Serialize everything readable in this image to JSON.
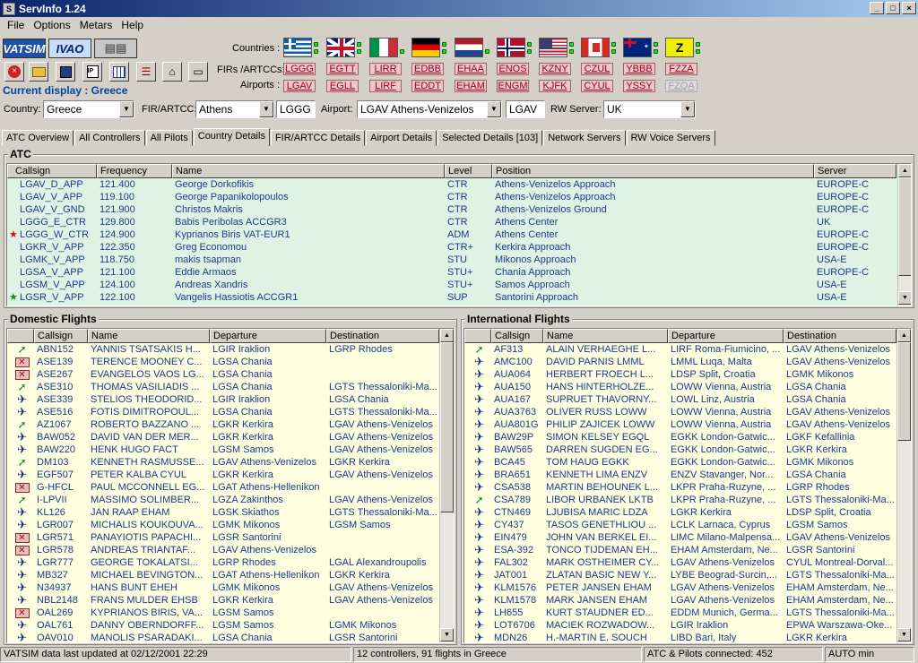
{
  "window": {
    "title": "ServInfo 1.24",
    "icon_text": "S"
  },
  "menu": [
    "File",
    "Options",
    "Metars",
    "Help"
  ],
  "logos": {
    "vatsim": "VATSIM",
    "ivao": "IVAO"
  },
  "toolbar": {
    "icons": [
      "close-icon",
      "folder-icon",
      "save-icon",
      "flightplan-icon",
      "grid-icon",
      "list-icon",
      "binoculars-icon",
      "message-icon"
    ]
  },
  "current_display": "Current display : Greece",
  "labels": {
    "countries": "Countries :",
    "firs": "FIRs /ARTCCs:",
    "airports": "Airports :",
    "country": "Country:",
    "fir": "FIR/ARTCC:",
    "airport": "Airport:",
    "rw_server": "RW Server:"
  },
  "flags": [
    {
      "name": "greece"
    },
    {
      "name": "united-kingdom"
    },
    {
      "name": "italy"
    },
    {
      "name": "germany"
    },
    {
      "name": "netherlands"
    },
    {
      "name": "norway"
    },
    {
      "name": "usa"
    },
    {
      "name": "canada"
    },
    {
      "name": "australia"
    },
    {
      "name": "z",
      "text": "Z"
    }
  ],
  "firs": [
    "LGGG",
    "EGTT",
    "LIRR",
    "EDBB",
    "EHAA",
    "ENOS",
    "KZNY",
    "CZUL",
    "YBBB",
    "FZZA"
  ],
  "airports": [
    "LGAV",
    "EGLL",
    "LIRF",
    "EDDT",
    "EHAM",
    "ENGM",
    "KJFK",
    "CYUL",
    "YSSY",
    "FZQA"
  ],
  "combos": {
    "country": "Greece",
    "fir": "Athens",
    "fir_code": "LGGG",
    "airport": "LGAV Athens-Venizelos",
    "airport_code": "LGAV",
    "rw_server": "UK"
  },
  "tabs": [
    "ATC Overview",
    "All Controllers",
    "All Pilots",
    "Country Details",
    "FIR/ARTCC Details",
    "Airport Details",
    "Selected Details [103]",
    "Network Servers",
    "RW Voice Servers"
  ],
  "atc": {
    "title": "ATC",
    "headers": [
      "Callsign",
      "Frequency",
      "Name",
      "Level",
      "Position",
      "Server"
    ],
    "rows": [
      [
        "LGAV_D_APP",
        "121.400",
        "George Dorkofikis",
        "CTR",
        "Athens-Venizelos Approach",
        "EUROPE-C",
        ""
      ],
      [
        "LGAV_V_APP",
        "119.100",
        "George Papanikolopoulos",
        "CTR",
        "Athens-Venizelos Approach",
        "EUROPE-C",
        ""
      ],
      [
        "LGAV_V_GND",
        "121.900",
        "Christos Makris",
        "CTR",
        "Athens-Venizelos Ground",
        "EUROPE-C",
        ""
      ],
      [
        "LGGG_E_CTR",
        "129.800",
        "Babis Peribolas ACCGR3",
        "CTR",
        "Athens Center",
        "UK",
        ""
      ],
      [
        "LGGG_W_CTR",
        "124.900",
        "Kyprianos Biris VAT-EUR1",
        "ADM",
        "Athens Center",
        "EUROPE-C",
        "red"
      ],
      [
        "LGKR_V_APP",
        "122.350",
        "Greg Economou",
        "CTR+",
        "Kerkira Approach",
        "EUROPE-C",
        ""
      ],
      [
        "LGMK_V_APP",
        "118.750",
        "makis tsapman",
        "STU",
        "Mikonos Approach",
        "USA-E",
        ""
      ],
      [
        "LGSA_V_APP",
        "121.100",
        "Eddie Armaos",
        "STU+",
        "Chania Approach",
        "EUROPE-C",
        ""
      ],
      [
        "LGSM_V_APP",
        "124.100",
        "Andreas Xandris",
        "STU+",
        "Samos Approach",
        "USA-E",
        ""
      ],
      [
        "LGSR_V_APP",
        "122.100",
        "Vangelis Hassiotis ACCGR1",
        "SUP",
        "Santorini Approach",
        "USA-E",
        "green"
      ]
    ]
  },
  "domestic": {
    "title": "Domestic Flights",
    "headers": [
      "Callsign",
      "Name",
      "Departure",
      "Destination"
    ],
    "rows": [
      [
        "ABN152",
        "YANNIS TSATSAKIS H...",
        "LGIR Iraklion",
        "LGRP Rhodes",
        "s"
      ],
      [
        "ASE139",
        "TERENCE MOONEY C...",
        "LGSA Chania",
        "",
        "x"
      ],
      [
        "ASE267",
        "EVANGELOS VAOS LG...",
        "LGSA Chania",
        "",
        "x"
      ],
      [
        "ASE310",
        "THOMAS VASILIADIS ...",
        "LGSA Chania",
        "LGTS Thessaloniki-Ma...",
        "s"
      ],
      [
        "ASE339",
        "STELIOS THEODORID...",
        "LGIR Iraklion",
        "LGSA Chania",
        "p"
      ],
      [
        "ASE516",
        "FOTIS DIMITROPOUL...",
        "LGSA Chania",
        "LGTS Thessaloniki-Ma...",
        "p"
      ],
      [
        "AZ1067",
        "ROBERTO BAZZANO ...",
        "LGKR Kerkira",
        "LGAV Athens-Venizelos",
        "s"
      ],
      [
        "BAW052",
        "DAVID VAN DER MER...",
        "LGKR Kerkira",
        "LGAV Athens-Venizelos",
        "p"
      ],
      [
        "BAW220",
        "HENK HUGO FACT",
        "LGSM Samos",
        "LGAV Athens-Venizelos",
        "p"
      ],
      [
        "DM103",
        "KENNETH RASMUSSE...",
        "LGAV Athens-Venizelos",
        "LGKR Kerkira",
        "s"
      ],
      [
        "EGF507",
        "PETER KALBA CYUL",
        "LGKR Kerkira",
        "LGAV Athens-Venizelos",
        "p"
      ],
      [
        "G-HFCL",
        "PAUL MCCONNELL EG...",
        "LGAT Athens-Hellenikon",
        "",
        "x"
      ],
      [
        "I-LPVII",
        "MASSIMO SOLIMBER...",
        "LGZA Zakinthos",
        "LGAV Athens-Venizelos",
        "s"
      ],
      [
        "KL126",
        "JAN RAAP EHAM",
        "LGSK Skiathos",
        "LGTS Thessaloniki-Ma...",
        "p"
      ],
      [
        "LGR007",
        "MICHALIS KOUKOUVA...",
        "LGMK Mikonos",
        "LGSM Samos",
        "p"
      ],
      [
        "LGR571",
        "PANAYIOTIS PAPACHI...",
        "LGSR Santorini",
        "",
        "x"
      ],
      [
        "LGR578",
        "ANDREAS TRIANTAF...",
        "LGAV Athens-Venizelos",
        "",
        "x"
      ],
      [
        "LGR777",
        "GEORGE TOKALATSI...",
        "LGRP Rhodes",
        "LGAL Alexandroupolis",
        "p"
      ],
      [
        "MB327",
        "MICHAEL BEVINGTON...",
        "LGAT Athens-Hellenikon",
        "LGKR Kerkira",
        "p"
      ],
      [
        "N34937",
        "HANS BUNT EHEH",
        "LGMK Mikonos",
        "LGAV Athens-Venizelos",
        "p"
      ],
      [
        "NBL2148",
        "FRANS MULDER EHSB",
        "LGKR Kerkira",
        "LGAV Athens-Venizelos",
        "p"
      ],
      [
        "OAL269",
        "KYPRIANOS BIRIS, VA...",
        "LGSM Samos",
        "",
        "x"
      ],
      [
        "OAL761",
        "DANNY OBERNDORFF...",
        "LGSM Samos",
        "LGMK Mikonos",
        "p"
      ],
      [
        "OAV010",
        "MANOLIS PSARADAKI...",
        "LGSA Chania",
        "LGSR Santorini",
        "p"
      ]
    ]
  },
  "international": {
    "title": "International Flights",
    "headers": [
      "Callsign",
      "Name",
      "Departure",
      "Destination"
    ],
    "rows": [
      [
        "AF313",
        "ALAIN VERHAEGHE L...",
        "LIRF Roma-Fiumicino, ...",
        "LGAV Athens-Venizelos",
        "s"
      ],
      [
        "AMC100",
        "DAVID PARNIS LMML",
        "LMML Luqa, Malta",
        "LGAV Athens-Venizelos",
        "p"
      ],
      [
        "AUA064",
        "HERBERT FROECH L...",
        "LDSP Split, Croatia",
        "LGMK Mikonos",
        "p"
      ],
      [
        "AUA150",
        "HANS HINTERHOLZE...",
        "LOWW Vienna, Austria",
        "LGSA Chania",
        "p"
      ],
      [
        "AUA167",
        "SUPRUET THAVORNY...",
        "LOWL Linz, Austria",
        "LGSA Chania",
        "p"
      ],
      [
        "AUA3763",
        "OLIVER RUSS LOWW",
        "LOWW Vienna, Austria",
        "LGAV Athens-Venizelos",
        "p"
      ],
      [
        "AUA801G",
        "PHILIP ZAJICEK LOWW",
        "LOWW Vienna, Austria",
        "LGAV Athens-Venizelos",
        "p"
      ],
      [
        "BAW29P",
        "SIMON KELSEY EGQL",
        "EGKK London-Gatwic...",
        "LGKF Kefallinia",
        "p"
      ],
      [
        "BAW565",
        "DARREN SUGDEN EG...",
        "EGKK London-Gatwic...",
        "LGKR Kerkira",
        "p"
      ],
      [
        "BCA45",
        "TOM HAUG EGKK",
        "EGKK London-Gatwic...",
        "LGMK Mikonos",
        "p"
      ],
      [
        "BRA651",
        "KENNETH LIMA ENZV",
        "ENZV Stavanger, Nor...",
        "LGSA Chania",
        "p"
      ],
      [
        "CSA538",
        "MARTIN BEHOUNEK L...",
        "LKPR Praha-Ruzyne, ...",
        "LGRP Rhodes",
        "p"
      ],
      [
        "CSA789",
        "LIBOR URBANEK LKTB",
        "LKPR Praha-Ruzyne, ...",
        "LGTS Thessaloniki-Ma...",
        "s"
      ],
      [
        "CTN469",
        "LJUBISA MARIC LDZA",
        "LGKR Kerkira",
        "LDSP Split, Croatia",
        "p"
      ],
      [
        "CY437",
        "TASOS GENETHLIOU ...",
        "LCLK Larnaca, Cyprus",
        "LGSM Samos",
        "p"
      ],
      [
        "EIN479",
        "JOHN VAN BERKEL EI...",
        "LIMC Milano-Malpensa...",
        "LGAV Athens-Venizelos",
        "p"
      ],
      [
        "ESA-392",
        "TONCO TIJDEMAN EH...",
        "EHAM Amsterdam, Ne...",
        "LGSR Santorini",
        "p"
      ],
      [
        "FAL302",
        "MARK OSTHEIMER CY...",
        "LGAV Athens-Venizelos",
        "CYUL Montreal-Dorval...",
        "p"
      ],
      [
        "JAT001",
        "ZLATAN BASIC NEW Y...",
        "LYBE Beograd-Surcin,...",
        "LGTS Thessaloniki-Ma...",
        "p"
      ],
      [
        "KLM1576",
        "PETER JANSEN EHAM",
        "LGAV Athens-Venizelos",
        "EHAM Amsterdam, Ne...",
        "p"
      ],
      [
        "KLM1578",
        "MARK JANSEN EHAM",
        "LGAV Athens-Venizelos",
        "EHAM Amsterdam, Ne...",
        "p"
      ],
      [
        "LH655",
        "KURT STAUDNER ED...",
        "EDDM Munich, Germa...",
        "LGTS Thessaloniki-Ma...",
        "p"
      ],
      [
        "LOT6706",
        "MACIEK ROZWADOW...",
        "LGIR Iraklion",
        "EPWA Warszawa-Oke...",
        "p"
      ],
      [
        "MDN26",
        "H.-MARTIN E. SOUCH",
        "LIBD Bari, Italy",
        "LGKR Kerkira",
        "p"
      ]
    ]
  },
  "status": {
    "updated": "VATSIM data last updated at 02/12/2001 22:29",
    "summary": "12 controllers, 91 flights in Greece",
    "connected": "ATC & Pilots connected: 452",
    "auto": "AUTO min"
  },
  "colors": {
    "atc_bg": "#dff3e4",
    "flights_bg": "#fefee0",
    "text_blue": "#1a3a8c",
    "chip_red": "#a00020"
  }
}
